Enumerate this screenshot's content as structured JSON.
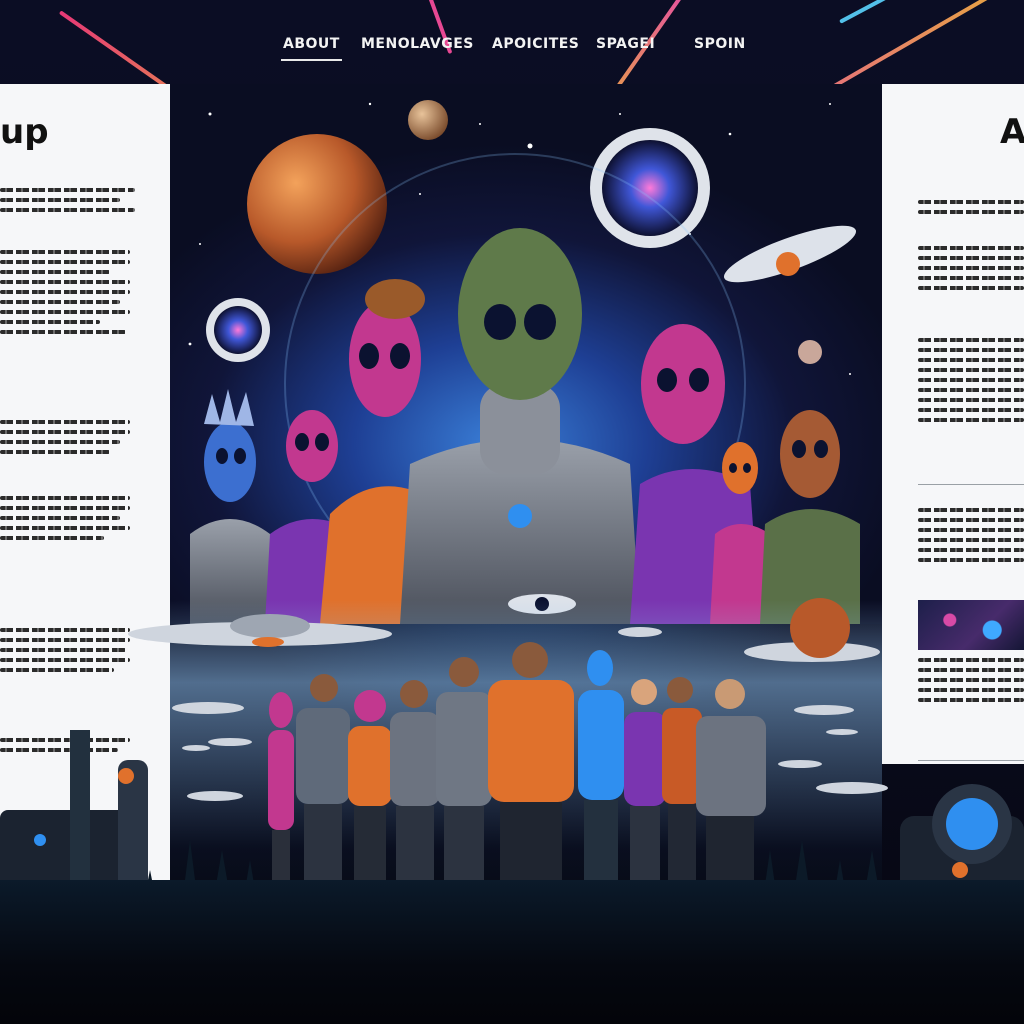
{
  "nav": {
    "items": [
      {
        "label": "ABOUT",
        "active": true
      },
      {
        "label": "MENOLAVGES",
        "active": false
      },
      {
        "label": "APOICITES",
        "active": false
      },
      {
        "label": "SPAGEI",
        "active": false
      },
      {
        "label": "SPOIN",
        "active": false
      }
    ]
  },
  "left_panel": {
    "title": "up"
  },
  "right_panel": {
    "title": "A"
  },
  "colors": {
    "background": "#07091a",
    "panel": "#f6f7f9",
    "accent_orange": "#e0712c",
    "accent_magenta": "#c2388f",
    "accent_blue": "#2f8ff0"
  }
}
